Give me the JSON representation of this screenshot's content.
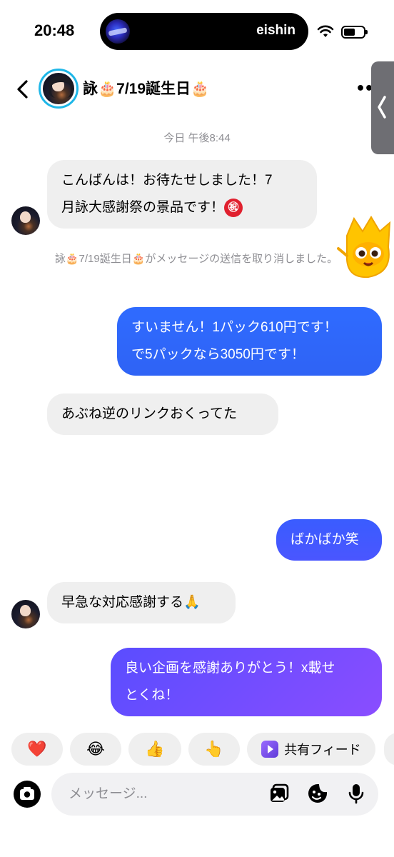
{
  "status_bar": {
    "time": "20:48",
    "live_activity_name": "eishin",
    "icons": [
      "wifi-icon",
      "battery-icon"
    ]
  },
  "header": {
    "back_icon": "chevron-left-icon",
    "contact_name": "詠🎂7/19誕生日🎂",
    "more_label": "••",
    "side_tab_icon": "chevron-left-icon"
  },
  "chat": {
    "timestamp": "今日 午後8:44",
    "messages": [
      {
        "sender": "them",
        "text_line1": "こんばんは！お待たせしました！7",
        "text_line2": "月詠大感謝祭の景品です！",
        "emoji": "㊗"
      },
      {
        "sender": "system",
        "text": "詠🎂7/19誕生日🎂がメッセージの送信を取り消しました。"
      },
      {
        "sender": "me",
        "text_line1": "すいません！1パック610円です！",
        "text_line2": "で5パックなら3050円です！"
      },
      {
        "sender": "them",
        "text": "あぶね逆のリンクおくってた"
      },
      {
        "sender": "me",
        "text": "ばかばか笑"
      },
      {
        "sender": "them",
        "text": "早急な対応感謝する🙏"
      },
      {
        "sender": "me",
        "text_line1": "良い企画を感謝ありがとう！x載せ",
        "text_line2": "とくね！"
      }
    ]
  },
  "quick_reactions": [
    {
      "emoji": "❤️",
      "icon": "heart-icon"
    },
    {
      "emoji": "😂",
      "icon": "laughing-face-icon"
    },
    {
      "emoji": "👍",
      "icon": "thumbs-up-icon"
    },
    {
      "emoji": "👆",
      "icon": "pointing-up-icon"
    },
    {
      "label": "共有フィード",
      "icon": "shared-feed-icon"
    }
  ],
  "composer": {
    "placeholder": "メッセージ...",
    "icons": [
      "camera-icon",
      "gallery-icon",
      "sticker-icon",
      "microphone-icon"
    ]
  },
  "colors": {
    "outgoing_blue": "#2f6bff",
    "outgoing_purple": "#8a4dff",
    "incoming_bg": "#efefef",
    "story_ring": "#1fb7e8"
  }
}
